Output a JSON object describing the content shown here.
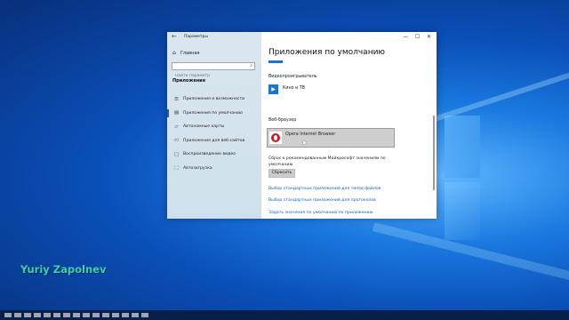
{
  "window": {
    "title": "Параметры",
    "back_icon": "back-arrow-icon",
    "controls": [
      "—",
      "☐",
      "✕"
    ]
  },
  "sidebar": {
    "home_label": "Главная",
    "search_placeholder": "Найти параметр",
    "section_title": "Приложения",
    "items": [
      {
        "label": "Приложения и возможности",
        "icon": "list-icon"
      },
      {
        "label": "Приложения по умолчанию",
        "icon": "default-apps-icon"
      },
      {
        "label": "Автономные карты",
        "icon": "map-icon"
      },
      {
        "label": "Приложения для веб-сайтов",
        "icon": "web-icon"
      },
      {
        "label": "Воспроизведение видео",
        "icon": "video-icon"
      },
      {
        "label": "Автозагрузка",
        "icon": "startup-icon"
      }
    ]
  },
  "main": {
    "title": "Приложения по умолчанию",
    "video_label": "Видеопроигрыватель",
    "video_app": "Кино и ТВ",
    "browser_label": "Веб-браузер",
    "browser_app": "Opera Internet Browser",
    "reset_text": "Сброс к рекомендованным Майкрософт значениям по умолчанию",
    "reset_button": "Сбросить",
    "links": [
      "Выбор стандартных приложений для типов файлов",
      "Выбор стандартных приложений для протоколов",
      "Задать значения по умолчанию по приложению"
    ]
  },
  "watermark": "Yuriy Zapolnev",
  "colors": {
    "accent": "#1a73d9",
    "link": "#1a5fb4",
    "watermark": "#3bd2a6"
  }
}
